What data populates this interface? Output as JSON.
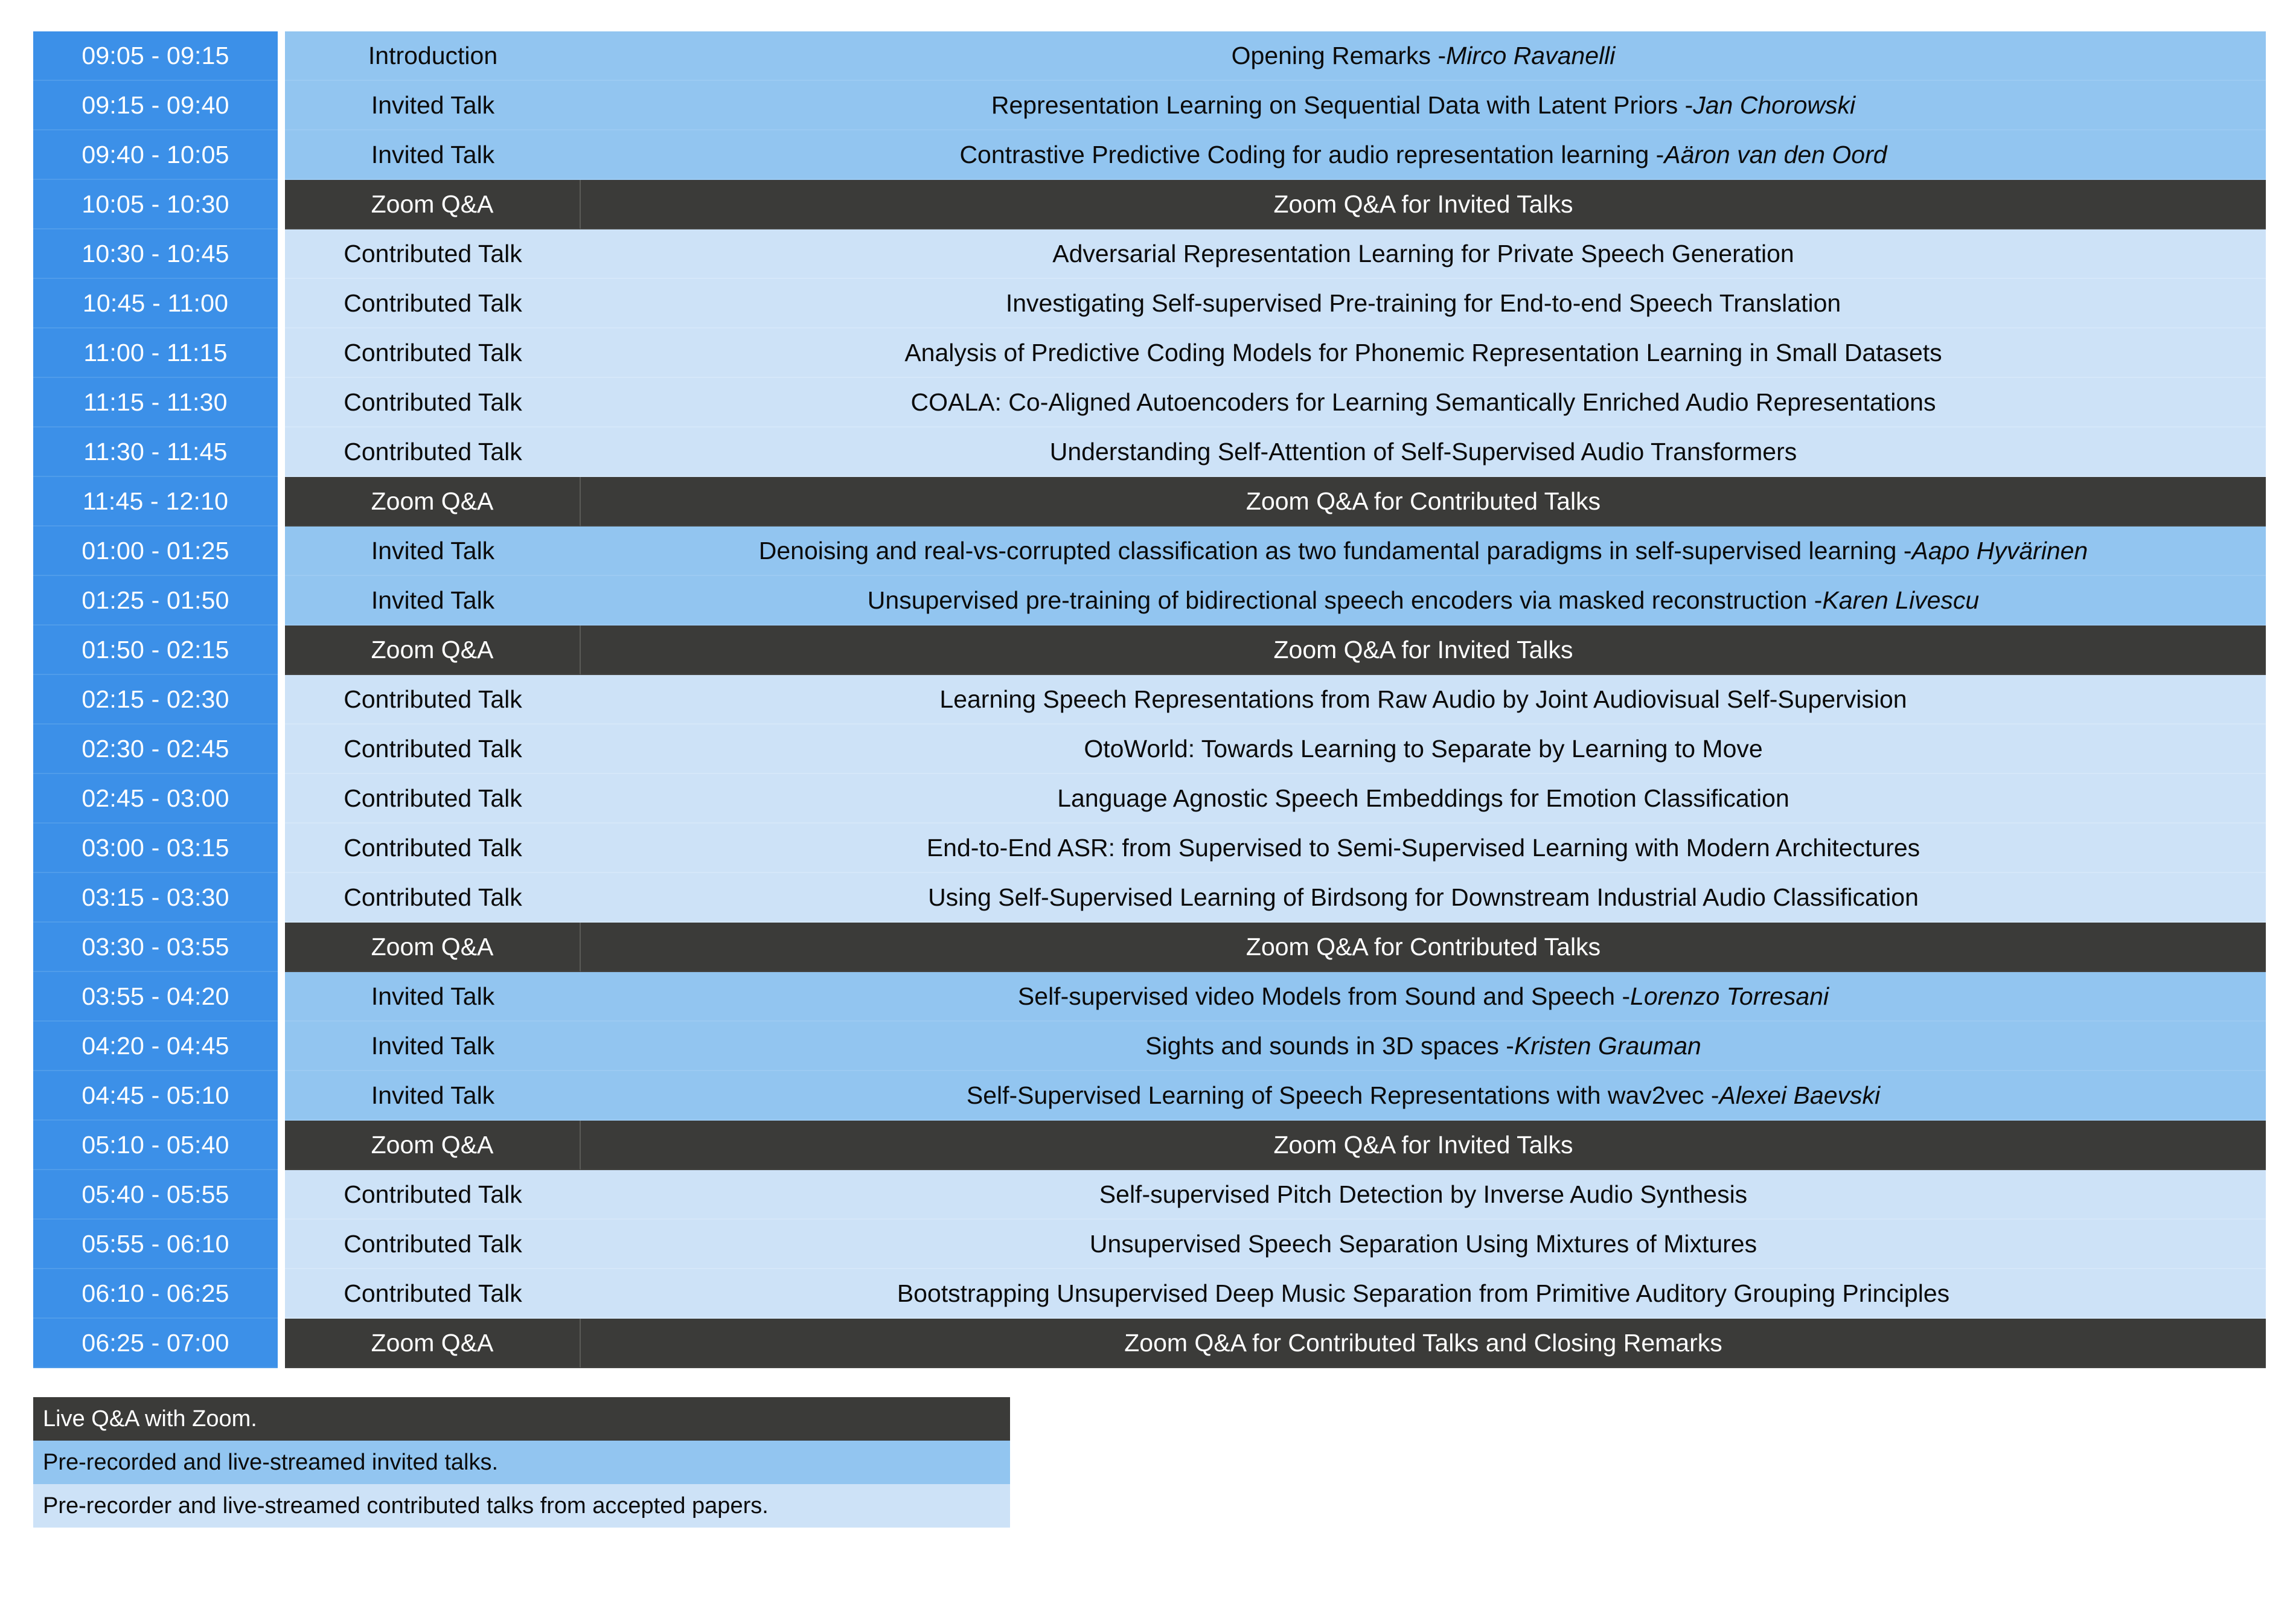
{
  "schedule": {
    "rows": [
      {
        "time": "09:05 - 09:15",
        "type": "Introduction",
        "kind": "invited",
        "title": "Opening Remarks - ",
        "speaker": "Mirco Ravanelli"
      },
      {
        "time": "09:15 - 09:40",
        "type": "Invited Talk",
        "kind": "invited",
        "title": "Representation Learning on Sequential Data with Latent Priors - ",
        "speaker": "Jan Chorowski"
      },
      {
        "time": "09:40 - 10:05",
        "type": "Invited Talk",
        "kind": "invited",
        "title": "Contrastive Predictive Coding for audio representation learning - ",
        "speaker": "Aäron van den Oord"
      },
      {
        "time": "10:05 - 10:30",
        "type": "Zoom Q&A",
        "kind": "qa",
        "title": "Zoom Q&A for Invited Talks",
        "speaker": ""
      },
      {
        "time": "10:30 - 10:45",
        "type": "Contributed Talk",
        "kind": "contributed",
        "title": "Adversarial Representation Learning for Private Speech Generation",
        "speaker": ""
      },
      {
        "time": "10:45 - 11:00",
        "type": "Contributed Talk",
        "kind": "contributed",
        "title": "Investigating Self-supervised Pre-training for End-to-end Speech Translation",
        "speaker": ""
      },
      {
        "time": "11:00 - 11:15",
        "type": "Contributed Talk",
        "kind": "contributed",
        "title": "Analysis of Predictive Coding Models for Phonemic Representation Learning in Small Datasets",
        "speaker": ""
      },
      {
        "time": "11:15 - 11:30",
        "type": "Contributed Talk",
        "kind": "contributed",
        "title": "COALA: Co-Aligned Autoencoders for Learning Semantically Enriched Audio Representations",
        "speaker": ""
      },
      {
        "time": "11:30 - 11:45",
        "type": "Contributed Talk",
        "kind": "contributed",
        "title": "Understanding Self-Attention of Self-Supervised Audio Transformers",
        "speaker": ""
      },
      {
        "time": "11:45 - 12:10",
        "type": "Zoom Q&A",
        "kind": "qa",
        "title": "Zoom Q&A for Contributed Talks",
        "speaker": ""
      },
      {
        "time": "01:00 - 01:25",
        "type": "Invited Talk",
        "kind": "invited",
        "title": "Denoising and real-vs-corrupted classification as two fundamental paradigms in self-supervised learning - ",
        "speaker": "Aapo Hyvärinen"
      },
      {
        "time": "01:25 - 01:50",
        "type": "Invited Talk",
        "kind": "invited",
        "title": "Unsupervised pre-training of bidirectional speech encoders via masked reconstruction - ",
        "speaker": "Karen Livescu"
      },
      {
        "time": "01:50 - 02:15",
        "type": "Zoom Q&A",
        "kind": "qa",
        "title": "Zoom Q&A for Invited Talks",
        "speaker": ""
      },
      {
        "time": "02:15 - 02:30",
        "type": "Contributed Talk",
        "kind": "contributed",
        "title": "Learning Speech Representations from Raw Audio by Joint Audiovisual Self-Supervision",
        "speaker": ""
      },
      {
        "time": "02:30 - 02:45",
        "type": "Contributed Talk",
        "kind": "contributed",
        "title": "OtoWorld: Towards Learning to Separate by Learning to Move",
        "speaker": ""
      },
      {
        "time": "02:45 - 03:00",
        "type": "Contributed Talk",
        "kind": "contributed",
        "title": "Language Agnostic Speech Embeddings for Emotion Classification",
        "speaker": ""
      },
      {
        "time": "03:00 - 03:15",
        "type": "Contributed Talk",
        "kind": "contributed",
        "title": "End-to-End ASR: from Supervised to Semi-Supervised Learning with Modern Architectures",
        "speaker": ""
      },
      {
        "time": "03:15 - 03:30",
        "type": "Contributed Talk",
        "kind": "contributed",
        "title": "Using Self-Supervised Learning of Birdsong for Downstream Industrial Audio Classification",
        "speaker": ""
      },
      {
        "time": "03:30 - 03:55",
        "type": "Zoom Q&A",
        "kind": "qa",
        "title": "Zoom Q&A for Contributed Talks",
        "speaker": ""
      },
      {
        "time": "03:55 - 04:20",
        "type": "Invited Talk",
        "kind": "invited",
        "title": "Self-supervised video Models from Sound and Speech - ",
        "speaker": "Lorenzo Torresani"
      },
      {
        "time": "04:20 - 04:45",
        "type": "Invited Talk",
        "kind": "invited",
        "title": "Sights and sounds in 3D spaces - ",
        "speaker": "Kristen Grauman"
      },
      {
        "time": "04:45 - 05:10",
        "type": "Invited Talk",
        "kind": "invited",
        "title": "Self-Supervised Learning of Speech Representations with wav2vec - ",
        "speaker": "Alexei Baevski"
      },
      {
        "time": "05:10 - 05:40",
        "type": "Zoom Q&A",
        "kind": "qa",
        "title": "Zoom Q&A for Invited Talks",
        "speaker": ""
      },
      {
        "time": "05:40 - 05:55",
        "type": "Contributed Talk",
        "kind": "contributed",
        "title": "Self-supervised Pitch Detection by Inverse Audio Synthesis",
        "speaker": ""
      },
      {
        "time": "05:55 - 06:10",
        "type": "Contributed Talk",
        "kind": "contributed",
        "title": "Unsupervised Speech Separation Using Mixtures of Mixtures",
        "speaker": ""
      },
      {
        "time": "06:10 - 06:25",
        "type": "Contributed Talk",
        "kind": "contributed",
        "title": "Bootstrapping Unsupervised Deep Music Separation from Primitive Auditory Grouping Principles",
        "speaker": ""
      },
      {
        "time": "06:25 - 07:00",
        "type": "Zoom Q&A",
        "kind": "qa",
        "title": "Zoom Q&A for Contributed Talks and Closing Remarks",
        "speaker": ""
      }
    ]
  },
  "legend": {
    "items": [
      {
        "kind": "qa",
        "label": "Live Q&A with Zoom."
      },
      {
        "kind": "invited",
        "label": "Pre-recorded and live-streamed invited talks."
      },
      {
        "kind": "contributed",
        "label": "Pre-recorder and live-streamed contributed talks from accepted papers."
      }
    ]
  },
  "colors": {
    "time_blue": "#3c90e8",
    "invited_blue": "#92c5f0",
    "contributed_blue": "#cde2f7",
    "qa_dark": "#3b3b39",
    "text_dark": "#0b0b0b",
    "text_light": "#ffffff"
  }
}
